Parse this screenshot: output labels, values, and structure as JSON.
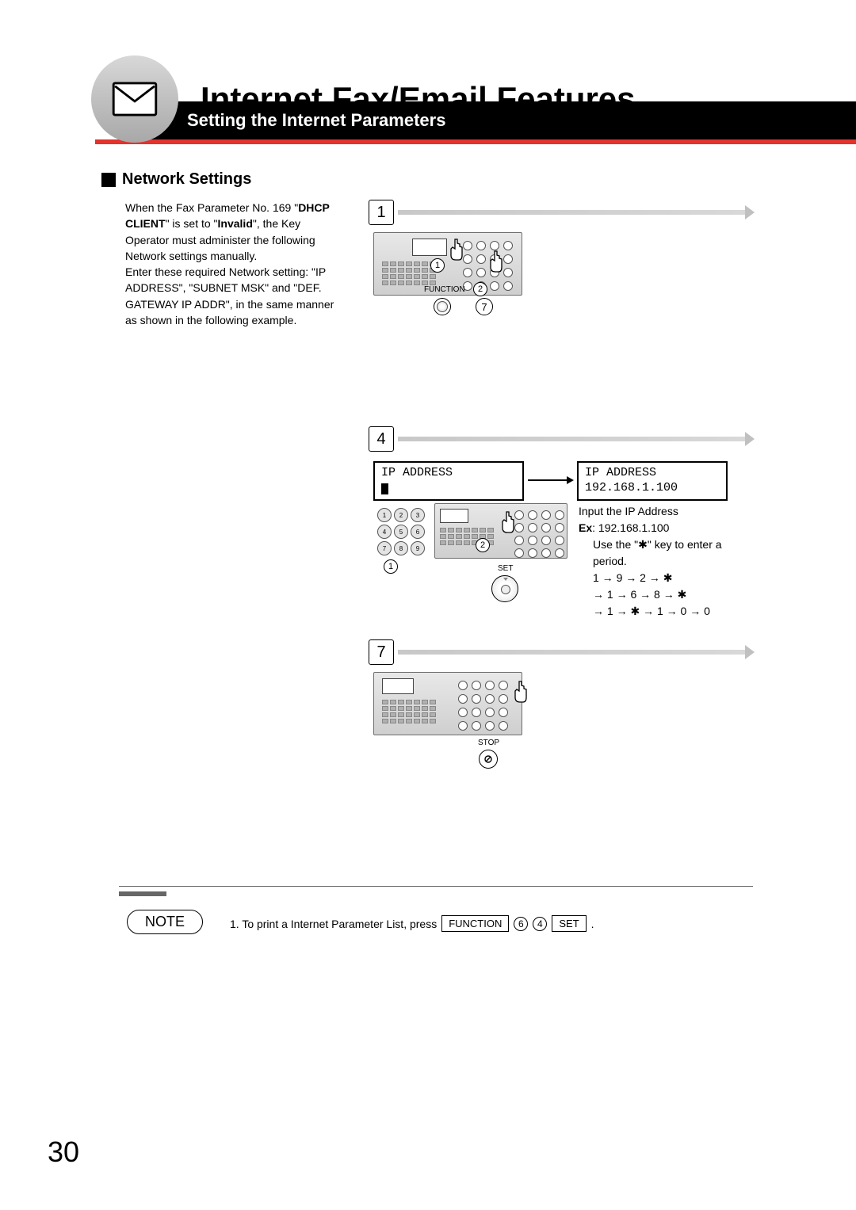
{
  "title": "Internet Fax/Email Features",
  "subtitle_bar": "Setting the Internet Parameters",
  "subheading": "Network Settings",
  "body": {
    "line1a": "When the Fax Parameter No. 169 \"",
    "line1b": "DHCP CLIENT",
    "line1c": "\" is set to \"",
    "line1d": "Invalid",
    "line1e": "\", the Key Operator must administer the following Network settings manually.",
    "line2": "Enter these required Network setting: \"IP ADDRESS\", \"SUBNET MSK\" and \"DEF. GATEWAY IP ADDR\", in the same manner as shown in the following example."
  },
  "step1": {
    "num": "1",
    "label_function": "FUNCTION",
    "circle1": "1",
    "circle2": "2",
    "btn7": "7"
  },
  "step4": {
    "num": "4",
    "lcd_left_line1": "IP ADDRESS",
    "lcd_right_line1": "IP ADDRESS",
    "lcd_right_line2": "192.168.1.100",
    "instr_line1": "Input the IP Address",
    "instr_ex_label": "Ex",
    "instr_ex_value": ": 192.168.1.100",
    "instr_star1": "Use the \"",
    "instr_star2": "\" key to enter a period.",
    "seq1": "1 → 9 → 2 → ✱",
    "seq2": "→ 1 → 6 → 8 → ✱",
    "seq3": "→ 1 → ✱ → 1 → 0 → 0",
    "circle1": "1",
    "circle2": "2",
    "label_set": "SET"
  },
  "step7": {
    "num": "7",
    "label_stop": "STOP"
  },
  "note": {
    "label": "NOTE",
    "text1": "1.  To print a Internet Parameter List, press",
    "key_function": "FUNCTION",
    "c6": "6",
    "c4": "4",
    "key_set": "SET",
    "period": "."
  },
  "page_number": "30",
  "star_glyph": "✱"
}
